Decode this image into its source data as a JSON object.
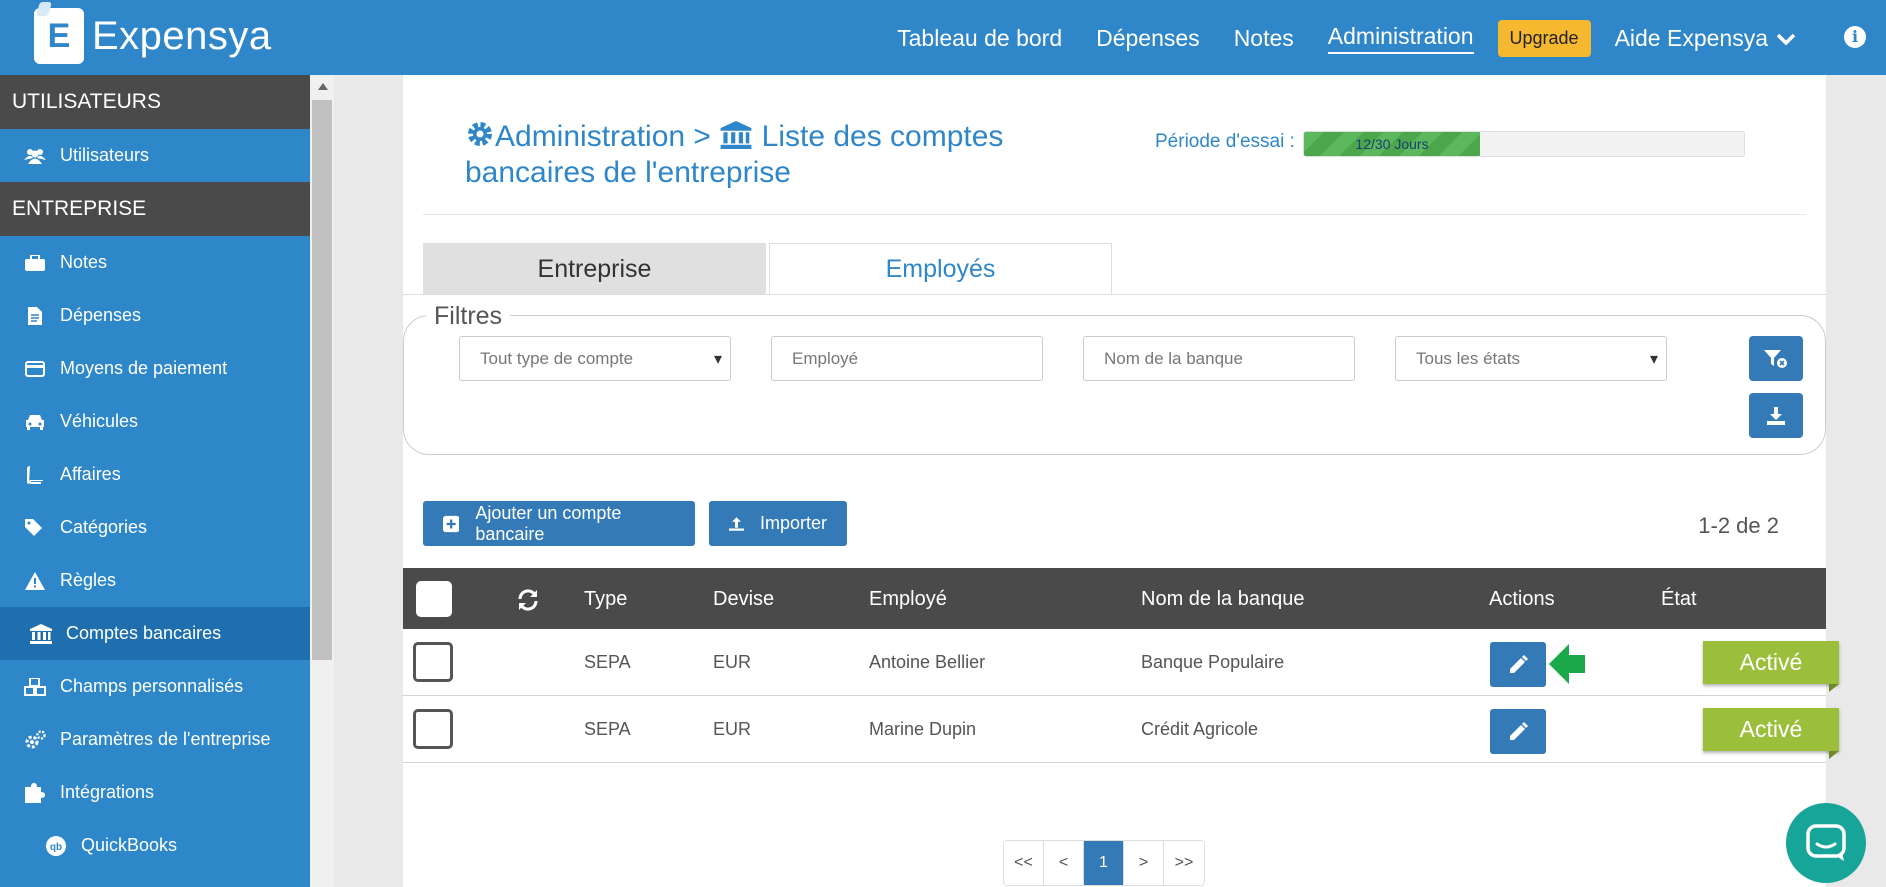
{
  "app": {
    "logo_letter": "E",
    "name": "Expensya"
  },
  "topnav": {
    "items": [
      "Tableau de bord",
      "Dépenses",
      "Notes",
      "Administration"
    ],
    "upgrade": "Upgrade",
    "help": "Aide Expensya"
  },
  "sidebar": {
    "sections": [
      {
        "title": "UTILISATEURS",
        "items": [
          {
            "label": "Utilisateurs",
            "icon": "users-icon"
          }
        ]
      },
      {
        "title": "ENTREPRISE",
        "items": [
          {
            "label": "Notes",
            "icon": "briefcase-icon"
          },
          {
            "label": "Dépenses",
            "icon": "file-icon"
          },
          {
            "label": "Moyens de paiement",
            "icon": "credit-card-icon"
          },
          {
            "label": "Véhicules",
            "icon": "car-icon"
          },
          {
            "label": "Affaires",
            "icon": "book-icon"
          },
          {
            "label": "Catégories",
            "icon": "tags-icon"
          },
          {
            "label": "Règles",
            "icon": "warning-icon"
          },
          {
            "label": "Comptes bancaires",
            "icon": "bank-icon"
          },
          {
            "label": "Champs personnalisés",
            "icon": "cubes-icon"
          },
          {
            "label": "Paramètres de l'entreprise",
            "icon": "gears-icon"
          },
          {
            "label": "Intégrations",
            "icon": "puzzle-icon"
          },
          {
            "label": "QuickBooks",
            "icon": "quickbooks-icon"
          }
        ]
      }
    ]
  },
  "header": {
    "crumb_admin": "Administration",
    "separator": ">",
    "page_title": "Liste des comptes bancaires de l'entreprise",
    "trial_label": "Période d'essai :",
    "trial_text": "12/30 Jours",
    "trial_progress": 0.4
  },
  "tabs": [
    "Entreprise",
    "Employés"
  ],
  "filters": {
    "legend": "Filtres",
    "account_type": "Tout type de compte",
    "employee_placeholder": "Employé",
    "bank_placeholder": "Nom de la banque",
    "state": "Tous les états"
  },
  "actions": {
    "add": "Ajouter un compte bancaire",
    "import": "Importer"
  },
  "count": "1-2 de 2",
  "table": {
    "columns": [
      "Type",
      "Devise",
      "Employé",
      "Nom de la banque",
      "Actions",
      "État"
    ],
    "rows": [
      {
        "type": "SEPA",
        "currency": "EUR",
        "employee": "Antoine Bellier",
        "bank": "Banque Populaire",
        "status": "Activé"
      },
      {
        "type": "SEPA",
        "currency": "EUR",
        "employee": "Marine Dupin",
        "bank": "Crédit Agricole",
        "status": "Activé"
      }
    ]
  },
  "pagination": [
    "<<",
    "<",
    "1",
    ">",
    ">>"
  ],
  "colors": {
    "brand": "#2f86c8",
    "button": "#337ab7",
    "status": "#9cbf3b",
    "upgrade": "#f5b82e",
    "chat": "#17a499",
    "arrow": "#1aa84b"
  }
}
